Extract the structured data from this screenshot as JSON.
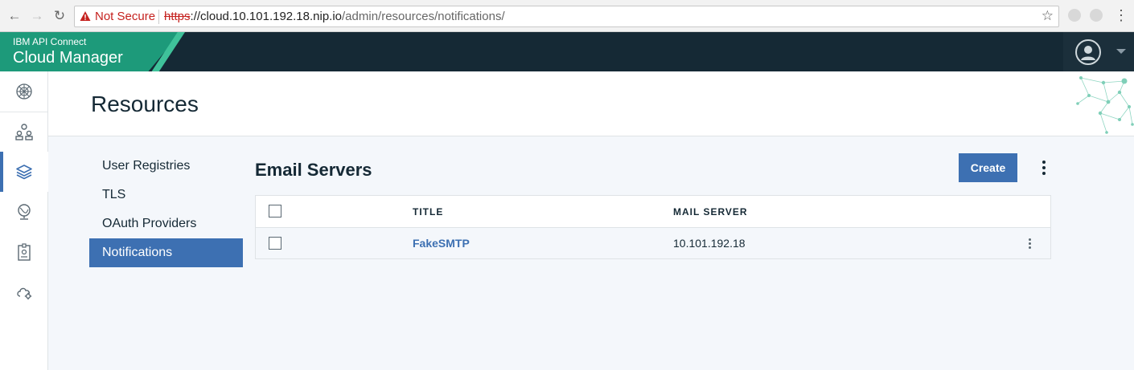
{
  "browser": {
    "not_secure": "Not Secure",
    "url_scheme": "https",
    "url_host": "://cloud.10.101.192.18.nip.io",
    "url_path": "/admin/resources/notifications/"
  },
  "header": {
    "brand_small": "IBM API Connect",
    "brand_title": "Cloud Manager"
  },
  "rail": {
    "items": [
      {
        "icon": "dashboard-icon"
      },
      {
        "icon": "provider-orgs-icon"
      },
      {
        "icon": "resources-layers-icon",
        "active": true
      },
      {
        "icon": "topology-globe-icon"
      },
      {
        "icon": "members-badge-icon"
      },
      {
        "icon": "cloud-settings-icon"
      }
    ]
  },
  "page": {
    "title": "Resources"
  },
  "subnav": {
    "items": [
      {
        "label": "User Registries"
      },
      {
        "label": "TLS"
      },
      {
        "label": "OAuth Providers"
      },
      {
        "label": "Notifications",
        "active": true
      }
    ]
  },
  "section": {
    "title": "Email Servers",
    "create_label": "Create"
  },
  "table": {
    "columns": [
      "TITLE",
      "MAIL SERVER"
    ],
    "rows": [
      {
        "title": "FakeSMTP",
        "mail_server": "10.101.192.18"
      }
    ]
  },
  "colors": {
    "accent": "#3d70b2",
    "header_bg": "#152935",
    "brand_green": "#1d9a7a"
  }
}
